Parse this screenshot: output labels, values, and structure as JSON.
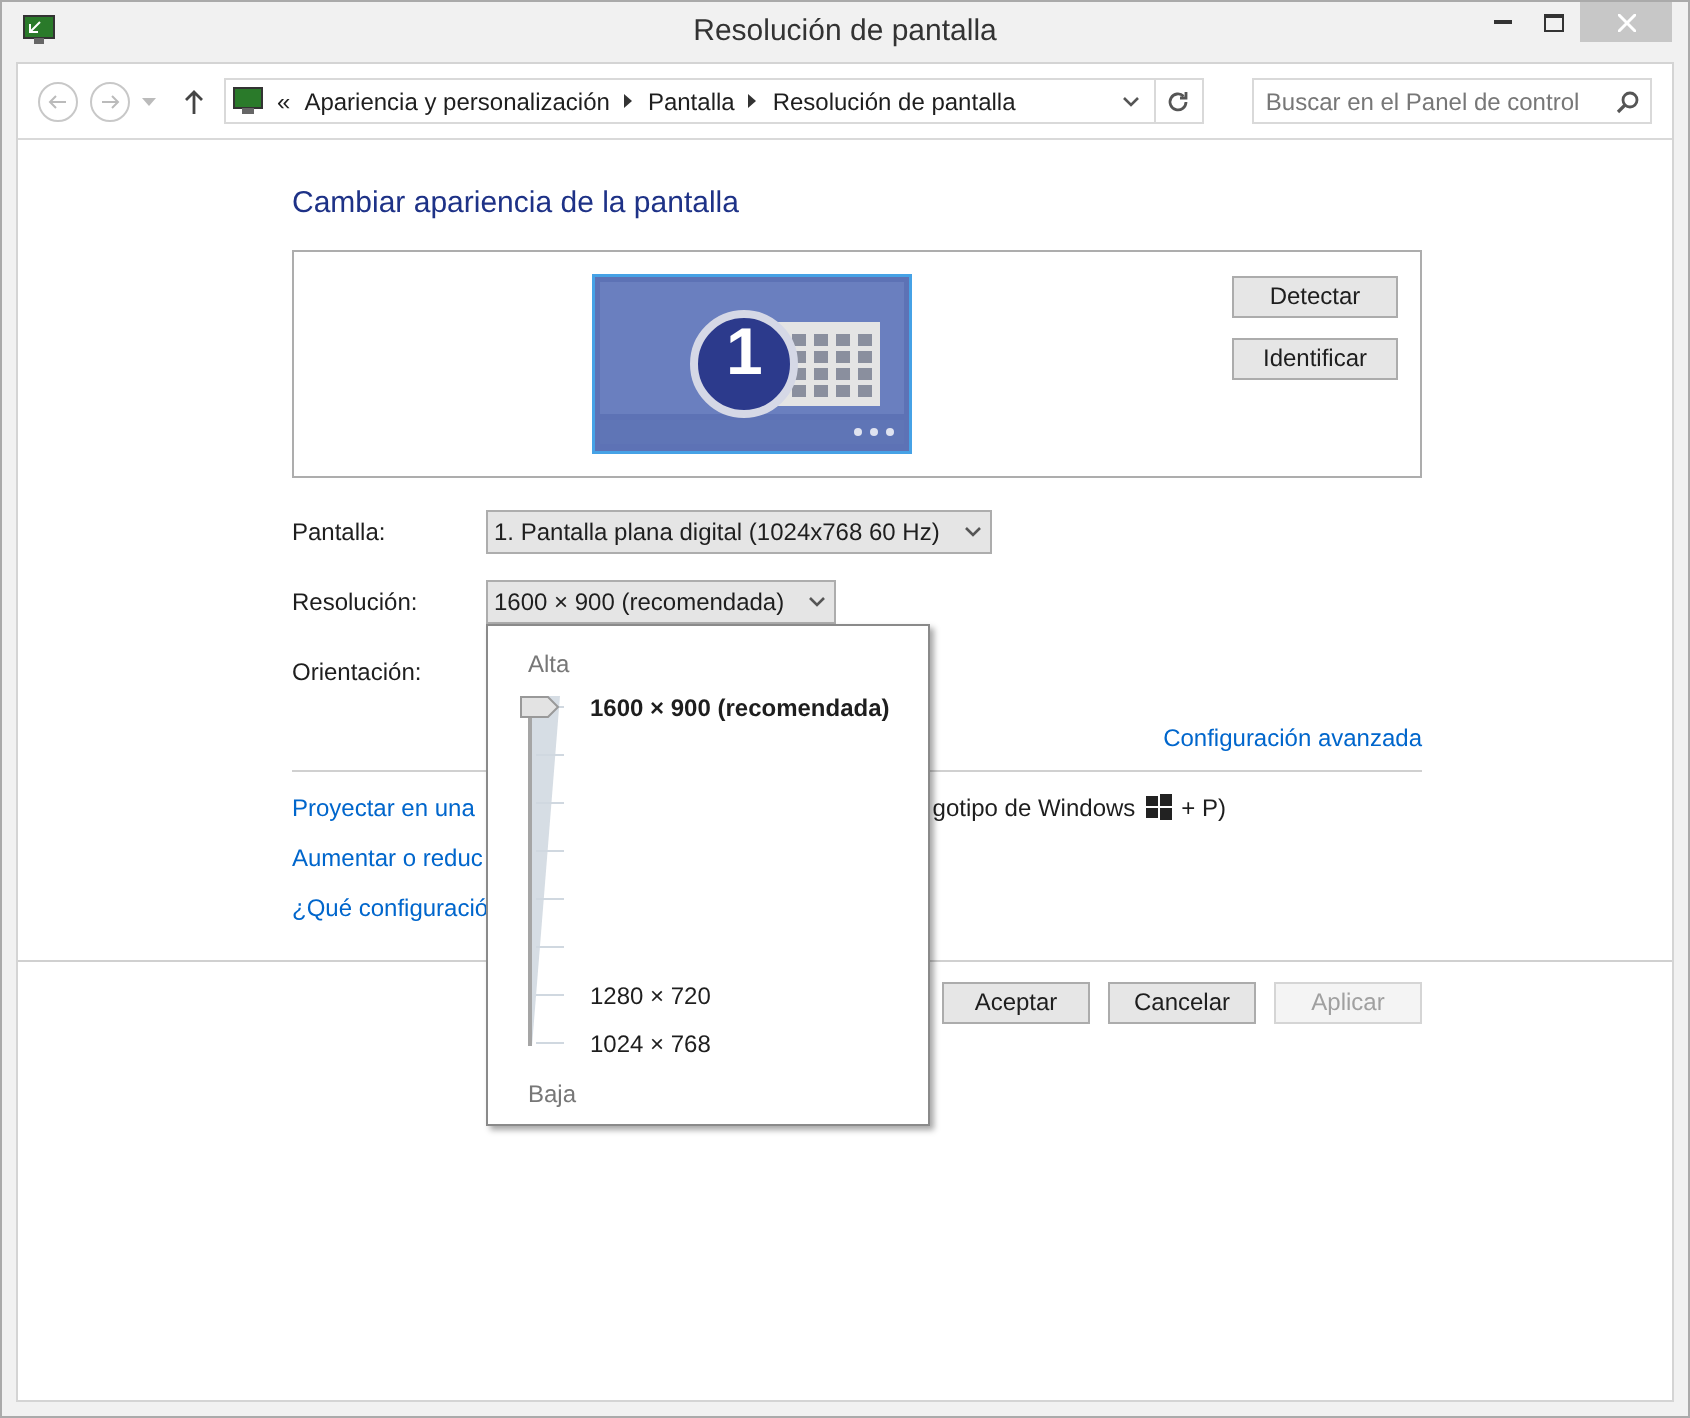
{
  "window": {
    "title": "Resolución de pantalla"
  },
  "address_bar": {
    "prefix": "«",
    "crumbs": [
      "Apariencia y personalización",
      "Pantalla",
      "Resolución de pantalla"
    ]
  },
  "search": {
    "placeholder": "Buscar en el Panel de control"
  },
  "heading": "Cambiar apariencia de la pantalla",
  "monitor": {
    "number": "1",
    "buttons": [
      "Detectar",
      "Identificar"
    ]
  },
  "fields": [
    {
      "label": "Pantalla:",
      "value": "1. Pantalla plana digital (1024x768 60 Hz)"
    },
    {
      "label": "Resolución:",
      "value": "1600 × 900 (recomendada)"
    },
    {
      "label": "Orientación:"
    }
  ],
  "advanced_link": "Configuración avanzada",
  "links": [
    {
      "left": "Proyectar en una",
      "right": "gotipo de Windows",
      "suffix": "+ P)"
    },
    {
      "left": "Aumentar o reduc"
    },
    {
      "left": "¿Qué configuració"
    }
  ],
  "buttons": [
    {
      "label": "Aceptar",
      "disabled": false
    },
    {
      "label": "Cancelar",
      "disabled": false
    },
    {
      "label": "Aplicar",
      "disabled": true
    }
  ],
  "resolution_popup": {
    "high": "Alta",
    "low": "Baja",
    "level": 1,
    "marks": [
      {
        "label": "1600 × 900 (recomendada)",
        "selected": true
      },
      {
        "label": "1280 × 720",
        "selected": false
      },
      {
        "label": "1024 × 768",
        "selected": false
      }
    ]
  }
}
